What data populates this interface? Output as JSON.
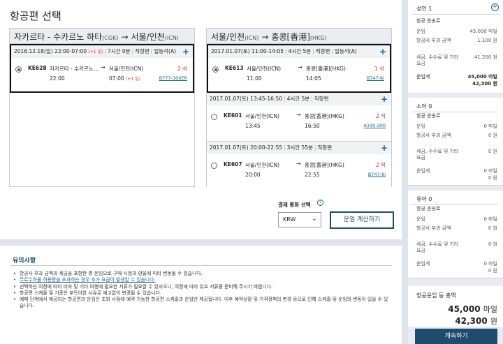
{
  "page": {
    "title": "항공편 선택"
  },
  "routes": [
    {
      "from": "자카르타 - 수카르노 하타",
      "from_code": "(CGK)",
      "to": "서울/인천",
      "to_code": "(ICN)",
      "flights": [
        {
          "date": "2016.12.18(일)",
          "time": "22:00-07:00",
          "next_day": "(+1 일)",
          "duration": "7시간 0분",
          "type": "직항편",
          "class": "일등석(A)",
          "flight_no": "KE628",
          "dep_city": "자카르타 - 수카르노...",
          "dep_time": "22:00",
          "arr_city": "서울/인천(ICN)",
          "arr_time": "07:00",
          "arr_next": "(+1 일)",
          "seats": "2 석",
          "aircraft": "B777-300ER",
          "selected": true
        }
      ]
    },
    {
      "from": "서울/인천",
      "from_code": "(ICN)",
      "to": "홍콩[香港]",
      "to_code": "(HKG)",
      "flights": [
        {
          "date": "2017.01.07(토)",
          "time": "11:00-14:05",
          "duration": "4시간 5분",
          "type": "직항편",
          "class": "일등석(A)",
          "flight_no": "KE613",
          "dep_city": "서울/인천(ICN)",
          "dep_time": "11:00",
          "arr_city": "홍콩[香港](HKG)",
          "arr_time": "14:05",
          "seats": "1 석",
          "aircraft": "B747-8i",
          "selected": true
        },
        {
          "date": "2017.01.07(토)",
          "time": "13:45-16:50",
          "duration": "4시간 5분",
          "type": "직항편",
          "flight_no": "KE601",
          "dep_city": "서울/인천(ICN)",
          "dep_time": "13:45",
          "arr_city": "홍콩[香港](HKG)",
          "arr_time": "16:50",
          "seats": "2 석",
          "aircraft": "A330-300",
          "selected": false
        },
        {
          "date": "2017.01.07(토)",
          "time": "20:00-22:55",
          "duration": "3시간 55분",
          "type": "직항편",
          "flight_no": "KE607",
          "dep_city": "서울/인천(ICN)",
          "dep_time": "20:00",
          "arr_city": "홍콩[香港](HKG)",
          "arr_time": "22:55",
          "seats": "2 석",
          "aircraft": "B747-8i",
          "selected": false
        }
      ]
    }
  ],
  "currency": {
    "label": "결제 통화 선택",
    "value": "KRW",
    "help_icon": "?",
    "calc_button": "운임 계산하기"
  },
  "notice": {
    "title": "유의사항",
    "items": [
      "항공사 부과 금액과 세금을 포함한 총 운임으로 구매 시점과 환율에 따라 변동될 수 있습니다.",
      "무료수하물 허용량을 초과하는 경우 추가 요금이 발생할 수 있습니다.",
      "선택하신 여정에 따라 비자 및 기타 여행에 필요한 서류가 필요할 수 있사오니, 여정에 따라 유효 서류를 준비해 주시기 바랍니다.",
      "항공편 스케줄 및 기종은 부득이한 사유로 예고없이 변경될 수 있습니다.",
      "예매 단계에서 제공되는 항공편과 운임은 조회 시점에 예약 가능한 항공편 스케줄과 운임만 제공됩니다. 이후 예약상황 및 가격정책의 변경 등으로 인해 스케줄 및 운임의 변동이 있을 수 있습니다."
    ]
  },
  "pax": {
    "adult": {
      "title": "성인 1",
      "plus": "+",
      "fare": "항공 운송료",
      "miles_label": "운임",
      "miles": "45,000 마일",
      "surcharge_label": "항공사 부과 금액",
      "surcharge": "1,100 원",
      "tax_label": "세금, 수수료 및 기타 요금",
      "tax": "41,200 원",
      "sum_label": "운임계",
      "sum_miles": "45,000 마일",
      "sum_won": "42,300 원"
    },
    "child": {
      "title": "소아 0",
      "fare": "항공 운송료",
      "miles_label": "운임",
      "miles": "0 마일",
      "surcharge_label": "항공사 부과 금액",
      "surcharge": "0 원",
      "tax_label": "세금, 수수료 및 기타 요금",
      "tax": "0 원",
      "sum_label": "운임계",
      "sum_miles": "0 마일",
      "sum_won": "0 원"
    },
    "infant": {
      "title": "유아 0",
      "fare": "항공 운송료",
      "miles_label": "운임",
      "miles": "0 마일",
      "surcharge_label": "항공사 부과 금액",
      "surcharge": "0 원",
      "tax_label": "세금, 수수료 및 기타 요금",
      "tax": "0 원",
      "sum_label": "운임계",
      "sum_miles": "0 마일",
      "sum_won": "0 원"
    }
  },
  "total": {
    "title": "항공운임 등 총액",
    "miles_num": "45,000",
    "miles_unit": "마일",
    "won_num": "42,300",
    "won_unit": "원"
  },
  "pay_button": "계속하기"
}
